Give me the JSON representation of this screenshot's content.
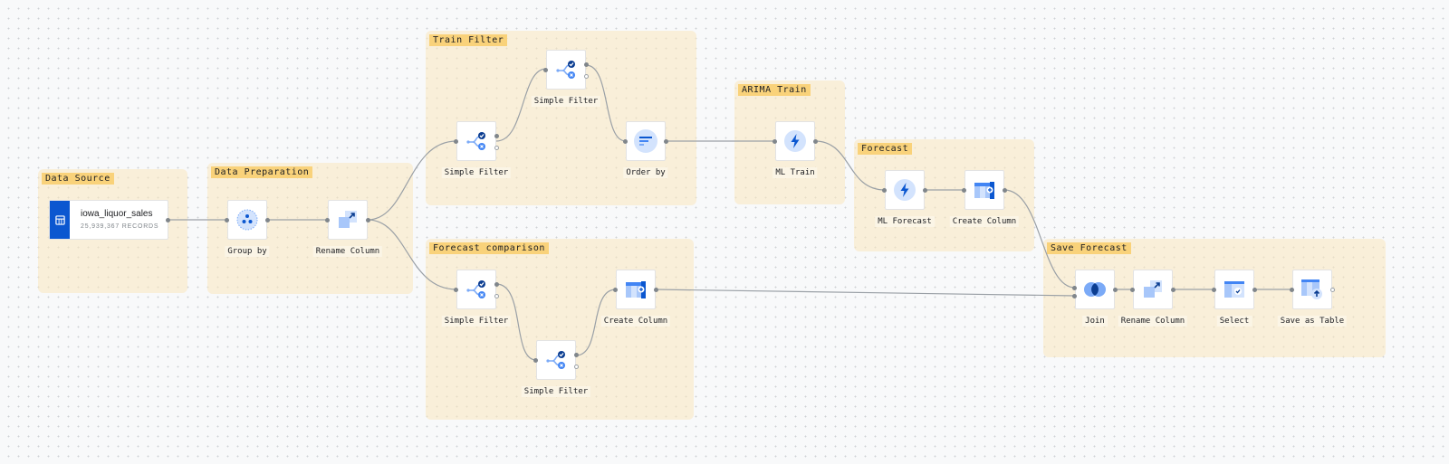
{
  "source": {
    "name": "iowa_liquor_sales",
    "records": "25,939,367 RECORDS",
    "icon": "table-icon"
  },
  "groups": {
    "data_source": "Data Source",
    "data_preparation": "Data Preparation",
    "train_filter": "Train Filter",
    "forecast_comparison": "Forecast comparison",
    "arima_train": "ARIMA Train",
    "forecast": "Forecast",
    "save_forecast": "Save Forecast"
  },
  "nodes": {
    "group_by": "Group by",
    "rename_column_1": "Rename Column",
    "train_filter_1": "Simple Filter",
    "train_filter_2": "Simple Filter",
    "order_by": "Order by",
    "comp_filter_1": "Simple Filter",
    "comp_filter_2": "Simple Filter",
    "comp_create_column": "Create Column",
    "ml_train": "ML Train",
    "ml_forecast": "ML Forecast",
    "fc_create_column": "Create Column",
    "join": "Join",
    "rename_column_2": "Rename Column",
    "select": "Select",
    "save_as_table": "Save as Table"
  },
  "colors": {
    "accent": "#0b57d0",
    "light_accent": "#a8c7fa",
    "group_bg": "#f7ebd0",
    "group_title": "#f9d27a"
  }
}
